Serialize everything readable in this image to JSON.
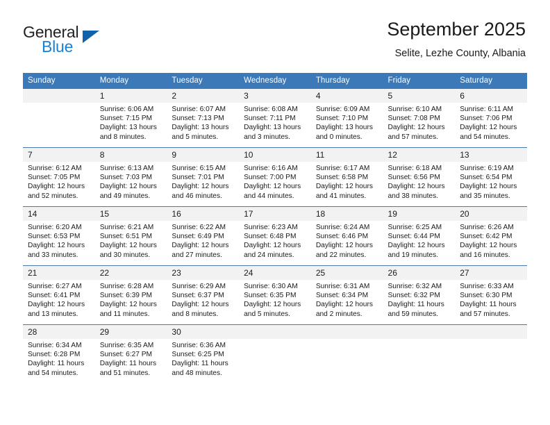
{
  "brand": {
    "name_part1": "General",
    "name_part2": "Blue",
    "logo_icon": "triangle-logo-icon",
    "accent_color": "#1b7fd4",
    "triangle_color": "#1261ab"
  },
  "header": {
    "title": "September 2025",
    "subtitle": "Selite, Lezhe County, Albania"
  },
  "colors": {
    "header_row_background": "#3b79b8",
    "header_row_text": "#ffffff",
    "daynum_background": "#f2f2f2",
    "row_divider": "#4a78a8",
    "body_text": "#1a1a1a"
  },
  "weekday_headers": [
    "Sunday",
    "Monday",
    "Tuesday",
    "Wednesday",
    "Thursday",
    "Friday",
    "Saturday"
  ],
  "weeks": [
    [
      {
        "day": "",
        "sunrise": "",
        "sunset": "",
        "daylight_line1": "",
        "daylight_line2": ""
      },
      {
        "day": "1",
        "sunrise": "Sunrise: 6:06 AM",
        "sunset": "Sunset: 7:15 PM",
        "daylight_line1": "Daylight: 13 hours",
        "daylight_line2": "and 8 minutes."
      },
      {
        "day": "2",
        "sunrise": "Sunrise: 6:07 AM",
        "sunset": "Sunset: 7:13 PM",
        "daylight_line1": "Daylight: 13 hours",
        "daylight_line2": "and 5 minutes."
      },
      {
        "day": "3",
        "sunrise": "Sunrise: 6:08 AM",
        "sunset": "Sunset: 7:11 PM",
        "daylight_line1": "Daylight: 13 hours",
        "daylight_line2": "and 3 minutes."
      },
      {
        "day": "4",
        "sunrise": "Sunrise: 6:09 AM",
        "sunset": "Sunset: 7:10 PM",
        "daylight_line1": "Daylight: 13 hours",
        "daylight_line2": "and 0 minutes."
      },
      {
        "day": "5",
        "sunrise": "Sunrise: 6:10 AM",
        "sunset": "Sunset: 7:08 PM",
        "daylight_line1": "Daylight: 12 hours",
        "daylight_line2": "and 57 minutes."
      },
      {
        "day": "6",
        "sunrise": "Sunrise: 6:11 AM",
        "sunset": "Sunset: 7:06 PM",
        "daylight_line1": "Daylight: 12 hours",
        "daylight_line2": "and 54 minutes."
      }
    ],
    [
      {
        "day": "7",
        "sunrise": "Sunrise: 6:12 AM",
        "sunset": "Sunset: 7:05 PM",
        "daylight_line1": "Daylight: 12 hours",
        "daylight_line2": "and 52 minutes."
      },
      {
        "day": "8",
        "sunrise": "Sunrise: 6:13 AM",
        "sunset": "Sunset: 7:03 PM",
        "daylight_line1": "Daylight: 12 hours",
        "daylight_line2": "and 49 minutes."
      },
      {
        "day": "9",
        "sunrise": "Sunrise: 6:15 AM",
        "sunset": "Sunset: 7:01 PM",
        "daylight_line1": "Daylight: 12 hours",
        "daylight_line2": "and 46 minutes."
      },
      {
        "day": "10",
        "sunrise": "Sunrise: 6:16 AM",
        "sunset": "Sunset: 7:00 PM",
        "daylight_line1": "Daylight: 12 hours",
        "daylight_line2": "and 44 minutes."
      },
      {
        "day": "11",
        "sunrise": "Sunrise: 6:17 AM",
        "sunset": "Sunset: 6:58 PM",
        "daylight_line1": "Daylight: 12 hours",
        "daylight_line2": "and 41 minutes."
      },
      {
        "day": "12",
        "sunrise": "Sunrise: 6:18 AM",
        "sunset": "Sunset: 6:56 PM",
        "daylight_line1": "Daylight: 12 hours",
        "daylight_line2": "and 38 minutes."
      },
      {
        "day": "13",
        "sunrise": "Sunrise: 6:19 AM",
        "sunset": "Sunset: 6:54 PM",
        "daylight_line1": "Daylight: 12 hours",
        "daylight_line2": "and 35 minutes."
      }
    ],
    [
      {
        "day": "14",
        "sunrise": "Sunrise: 6:20 AM",
        "sunset": "Sunset: 6:53 PM",
        "daylight_line1": "Daylight: 12 hours",
        "daylight_line2": "and 33 minutes."
      },
      {
        "day": "15",
        "sunrise": "Sunrise: 6:21 AM",
        "sunset": "Sunset: 6:51 PM",
        "daylight_line1": "Daylight: 12 hours",
        "daylight_line2": "and 30 minutes."
      },
      {
        "day": "16",
        "sunrise": "Sunrise: 6:22 AM",
        "sunset": "Sunset: 6:49 PM",
        "daylight_line1": "Daylight: 12 hours",
        "daylight_line2": "and 27 minutes."
      },
      {
        "day": "17",
        "sunrise": "Sunrise: 6:23 AM",
        "sunset": "Sunset: 6:48 PM",
        "daylight_line1": "Daylight: 12 hours",
        "daylight_line2": "and 24 minutes."
      },
      {
        "day": "18",
        "sunrise": "Sunrise: 6:24 AM",
        "sunset": "Sunset: 6:46 PM",
        "daylight_line1": "Daylight: 12 hours",
        "daylight_line2": "and 22 minutes."
      },
      {
        "day": "19",
        "sunrise": "Sunrise: 6:25 AM",
        "sunset": "Sunset: 6:44 PM",
        "daylight_line1": "Daylight: 12 hours",
        "daylight_line2": "and 19 minutes."
      },
      {
        "day": "20",
        "sunrise": "Sunrise: 6:26 AM",
        "sunset": "Sunset: 6:42 PM",
        "daylight_line1": "Daylight: 12 hours",
        "daylight_line2": "and 16 minutes."
      }
    ],
    [
      {
        "day": "21",
        "sunrise": "Sunrise: 6:27 AM",
        "sunset": "Sunset: 6:41 PM",
        "daylight_line1": "Daylight: 12 hours",
        "daylight_line2": "and 13 minutes."
      },
      {
        "day": "22",
        "sunrise": "Sunrise: 6:28 AM",
        "sunset": "Sunset: 6:39 PM",
        "daylight_line1": "Daylight: 12 hours",
        "daylight_line2": "and 11 minutes."
      },
      {
        "day": "23",
        "sunrise": "Sunrise: 6:29 AM",
        "sunset": "Sunset: 6:37 PM",
        "daylight_line1": "Daylight: 12 hours",
        "daylight_line2": "and 8 minutes."
      },
      {
        "day": "24",
        "sunrise": "Sunrise: 6:30 AM",
        "sunset": "Sunset: 6:35 PM",
        "daylight_line1": "Daylight: 12 hours",
        "daylight_line2": "and 5 minutes."
      },
      {
        "day": "25",
        "sunrise": "Sunrise: 6:31 AM",
        "sunset": "Sunset: 6:34 PM",
        "daylight_line1": "Daylight: 12 hours",
        "daylight_line2": "and 2 minutes."
      },
      {
        "day": "26",
        "sunrise": "Sunrise: 6:32 AM",
        "sunset": "Sunset: 6:32 PM",
        "daylight_line1": "Daylight: 11 hours",
        "daylight_line2": "and 59 minutes."
      },
      {
        "day": "27",
        "sunrise": "Sunrise: 6:33 AM",
        "sunset": "Sunset: 6:30 PM",
        "daylight_line1": "Daylight: 11 hours",
        "daylight_line2": "and 57 minutes."
      }
    ],
    [
      {
        "day": "28",
        "sunrise": "Sunrise: 6:34 AM",
        "sunset": "Sunset: 6:28 PM",
        "daylight_line1": "Daylight: 11 hours",
        "daylight_line2": "and 54 minutes."
      },
      {
        "day": "29",
        "sunrise": "Sunrise: 6:35 AM",
        "sunset": "Sunset: 6:27 PM",
        "daylight_line1": "Daylight: 11 hours",
        "daylight_line2": "and 51 minutes."
      },
      {
        "day": "30",
        "sunrise": "Sunrise: 6:36 AM",
        "sunset": "Sunset: 6:25 PM",
        "daylight_line1": "Daylight: 11 hours",
        "daylight_line2": "and 48 minutes."
      },
      {
        "day": "",
        "sunrise": "",
        "sunset": "",
        "daylight_line1": "",
        "daylight_line2": ""
      },
      {
        "day": "",
        "sunrise": "",
        "sunset": "",
        "daylight_line1": "",
        "daylight_line2": ""
      },
      {
        "day": "",
        "sunrise": "",
        "sunset": "",
        "daylight_line1": "",
        "daylight_line2": ""
      },
      {
        "day": "",
        "sunrise": "",
        "sunset": "",
        "daylight_line1": "",
        "daylight_line2": ""
      }
    ]
  ]
}
